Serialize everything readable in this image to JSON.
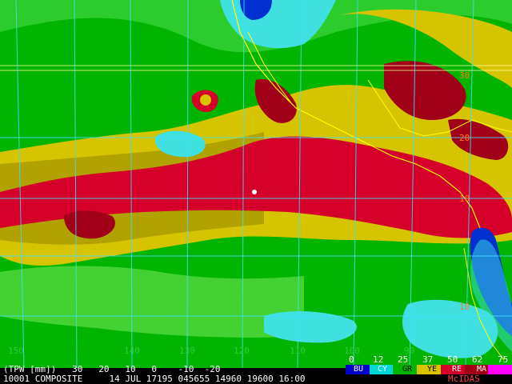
{
  "map": {
    "lon_labels": [
      "150",
      "140",
      "130",
      "120",
      "110",
      "100",
      "90"
    ],
    "lat_labels": [
      "30",
      "20",
      "10",
      "10"
    ],
    "colors": {
      "dark_red": "#a00018",
      "red": "#d4002a",
      "yellow": "#d6c400",
      "olive": "#a89a00",
      "green": "#00b400",
      "light_green": "#44d233",
      "cyan": "#00d8d8",
      "light_cyan": "#40e0e0",
      "blue": "#0030d0",
      "grid": "#40e0ff",
      "coast": "#ffff00"
    }
  },
  "legend": {
    "scale_values": [
      "0",
      "12",
      "25",
      "37",
      "50",
      "62",
      "75"
    ],
    "scale_colors": [
      "#0000c8",
      "#00d8d8",
      "#00b400",
      "#d6c400",
      "#d4002a",
      "#a00018",
      "#ff00ff"
    ],
    "swatch_labels": [
      "BU",
      "CY",
      "GR",
      "YE",
      "RE",
      "MA"
    ]
  },
  "footer": {
    "line1": "(TPW [mm])   30   20   10   0    -10  -20",
    "line2": "10001 COMPOSITE     14 JUL 17195 045655 14960 19600 16:00",
    "source": "McIDAS"
  }
}
